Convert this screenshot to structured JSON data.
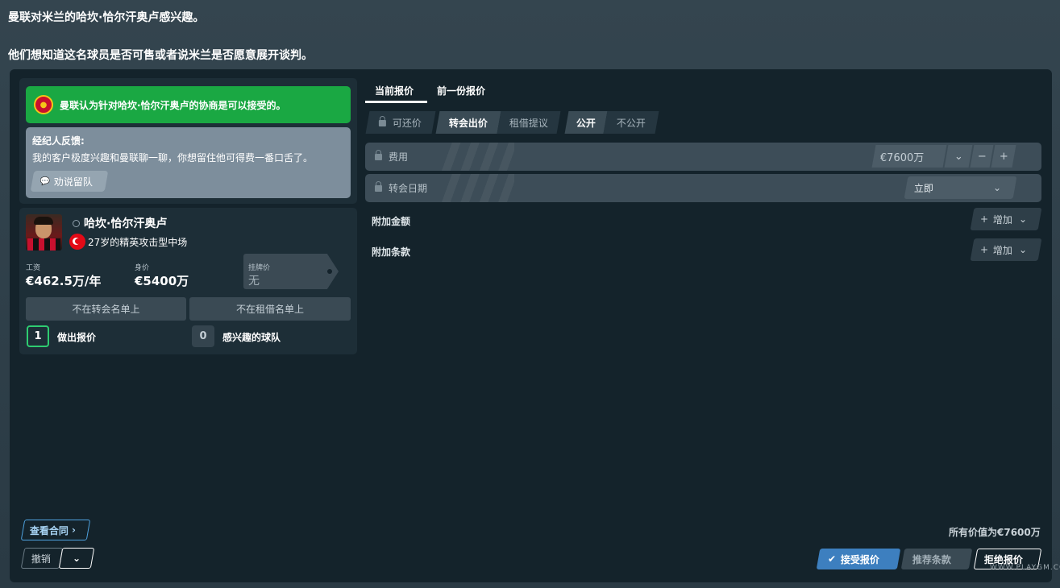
{
  "header": {
    "line1": "曼联对米兰的哈坎·恰尔汗奥卢感兴趣。",
    "line2": "他们想知道这名球员是否可售或者说米兰是否愿意展开谈判。"
  },
  "agent": {
    "club_message": "曼联认为针对哈坎·恰尔汗奥卢的协商是可以接受的。",
    "feedback_title": "经纪人反馈:",
    "feedback_text": "我的客户极度兴趣和曼联聊一聊，你想留住他可得费一番口舌了。",
    "persuade_button": "劝说留队"
  },
  "player": {
    "name": "哈坎·恰尔汗奥卢",
    "description": "27岁的精英攻击型中场",
    "wage_label": "工资",
    "wage_value": "€462.5万/年",
    "value_label": "身价",
    "value_value": "€5400万",
    "asking_label": "挂牌价",
    "asking_value": "无",
    "transfer_list": "不在转会名单上",
    "loan_list": "不在租借名单上",
    "offers_count": "1",
    "offers_label": "做出报价",
    "interested_count": "0",
    "interested_label": "感兴趣的球队"
  },
  "tabs": {
    "current": "当前报价",
    "previous": "前一份报价"
  },
  "options": {
    "negotiable": "可还价",
    "transfer": "转会出价",
    "loan": "租借提议",
    "public": "公开",
    "private": "不公开"
  },
  "fee": {
    "label": "费用",
    "value": "€7600万",
    "minus": "−",
    "plus": "+"
  },
  "transfer_date": {
    "label": "转会日期",
    "value": "立即"
  },
  "extras": {
    "add_amount_label": "附加金额",
    "add_clause_label": "附加条款",
    "add_button": "增加"
  },
  "summary": "所有价值为€7600万",
  "footer": {
    "view_contract": "查看合同",
    "undo": "撤销",
    "accept": "接受报价",
    "suggest": "推荐条款",
    "reject": "拒绝报价"
  },
  "watermark": "WWW.PLAYGM.CC",
  "colors": {
    "accent_green": "#1aa843",
    "accept_blue": "#3d7fbf",
    "offers_border": "#2ecc71"
  }
}
